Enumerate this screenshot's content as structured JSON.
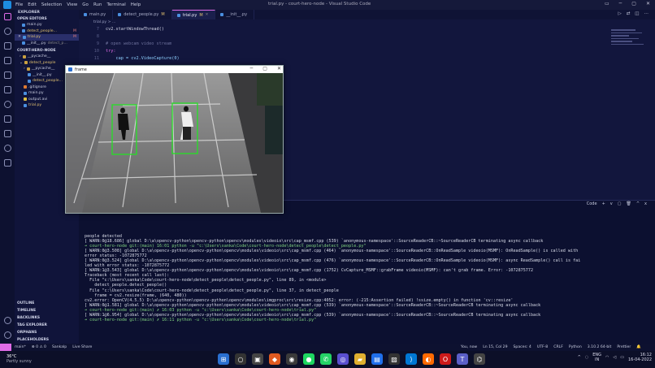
{
  "window": {
    "title": "trial.py - court-hero-node - Visual Studio Code",
    "menu": [
      "File",
      "Edit",
      "Selection",
      "View",
      "Go",
      "Run",
      "Terminal",
      "Help"
    ]
  },
  "sidebar": {
    "header": "EXPLORER",
    "open_editors_label": "OPEN EDITORS",
    "open_editors": [
      {
        "name": "main.py",
        "mark": ""
      },
      {
        "name": "detect_people...",
        "mark": "M"
      },
      {
        "name": "trial.py",
        "mark": "M"
      },
      {
        "name": "__init__.py",
        "mark": "detect_p..."
      }
    ],
    "project_label": "COURT-HERO-NODE",
    "tree": [
      {
        "name": "__pycache__",
        "kind": "folder"
      },
      {
        "name": "detect_people",
        "kind": "folder"
      },
      {
        "name": "__pycache__",
        "kind": "folder"
      },
      {
        "name": "__init__.py",
        "kind": "py"
      },
      {
        "name": "detect_people...",
        "kind": "py",
        "mark": "M"
      },
      {
        "name": ".gitignore",
        "kind": "git"
      },
      {
        "name": "main.py",
        "kind": "py"
      },
      {
        "name": "output.avi",
        "kind": "file"
      },
      {
        "name": "trial.py",
        "kind": "py"
      }
    ],
    "bottom_sections": [
      "OUTLINE",
      "TIMELINE",
      "BACKLINKS",
      "TAG EXPLORER",
      "ORPHANS",
      "PLACEHOLDERS"
    ]
  },
  "tabs": [
    {
      "label": "main.py",
      "mark": "",
      "active": false
    },
    {
      "label": "detect_people.py",
      "mark": "M",
      "active": false
    },
    {
      "label": "trial.py",
      "mark": "M",
      "active": true
    },
    {
      "label": "__init__.py",
      "mark": "",
      "active": false
    }
  ],
  "breadcrumb": "trial.py > ...",
  "code": {
    "top_line": "cv2.startWindowThread()",
    "lines": [
      {
        "n": "7",
        "text": "cv2.startWindowThread()",
        "cls": "c-tx"
      },
      {
        "n": "8",
        "text": "",
        "cls": "c-tx"
      },
      {
        "n": "9",
        "text": "# open webcam video stream",
        "cls": "c-cm"
      },
      {
        "n": "10",
        "text": "try:",
        "cls": "c-kw"
      },
      {
        "n": "11",
        "text": "    cap = cv2.VideoCapture(0)",
        "cls": "c-id"
      }
    ]
  },
  "frame_window": {
    "title": "frame",
    "detections": 2
  },
  "panel": {
    "toolbar": [
      "Code",
      "+",
      "v",
      "▢",
      "🗑",
      "^",
      "x"
    ]
  },
  "terminal": [
    {
      "cls": "tl-warn",
      "text": "people detected"
    },
    {
      "cls": "tl-warn",
      "text": "[ WARN:0@18.686] global D:\\a\\opencv-python\\opencv-python\\opencv\\modules\\videoio\\src\\cap_msmf.cpp (539) `anonymous-namespace'::SourceReaderCB::~SourceReaderCB terminating async callback"
    },
    {
      "cls": "tl-prompt",
      "text": "➜ court-hero-node git:(main) 16:01 python -u \"c:\\Users\\sanka\\Code\\court-hero-node\\detect_people\\detect_people.py\""
    },
    {
      "cls": "tl-warn",
      "text": "[ WARN:0@3.508] global D:\\a\\opencv-python\\opencv-python\\opencv\\modules\\videoio\\src\\cap_msmf.cpp (464) `anonymous-namespace'::SourceReaderCB::OnReadSample videoio(MSMF): OnReadSample() is called with"
    },
    {
      "cls": "tl-warn",
      "text": "error status: -1072875772"
    },
    {
      "cls": "tl-warn",
      "text": "[ WARN:0@3.524] global D:\\a\\opencv-python\\opencv-python\\opencv\\modules\\videoio\\src\\cap_msmf.cpp (476) `anonymous-namespace'::SourceReaderCB::OnReadSample videoio(MSMF): async ReadSample() call is fai"
    },
    {
      "cls": "tl-warn",
      "text": "led with error status: -1072875772"
    },
    {
      "cls": "tl-warn",
      "text": "[ WARN:1@3.543] global D:\\a\\opencv-python\\opencv-python\\opencv\\modules\\videoio\\src\\cap_msmf.cpp (1752) CvCapture_MSMF::grabFrame videoio(MSMF): can't grab frame. Error: -1072875772"
    },
    {
      "cls": "tl-warn",
      "text": "Traceback (most recent call last):"
    },
    {
      "cls": "tl-warn",
      "text": "  File \"c:\\Users\\sanka\\Code\\court-hero-node\\detect_people\\detect_people.py\", line 89, in <module>"
    },
    {
      "cls": "tl-warn",
      "text": "    detect_people.detect_people()"
    },
    {
      "cls": "tl-warn",
      "text": "  File \"c:\\Users\\sanka\\Code\\court-hero-node\\detect_people\\detect_people.py\", line 37, in detect_people"
    },
    {
      "cls": "tl-warn",
      "text": "    frame = cv2.resize(frame, (640, 480))"
    },
    {
      "cls": "tl-warn",
      "text": "cv2.error: OpenCV(4.5.5) D:\\a\\opencv-python\\opencv-python\\opencv\\modules\\imgproc\\src\\resize.cpp:4052: error: (-215:Assertion failed) !ssize.empty() in function 'cv::resize'"
    },
    {
      "cls": "tl-warn",
      "text": ""
    },
    {
      "cls": "tl-warn",
      "text": "[ WARN:0@1.581] global D:\\a\\opencv-python\\opencv-python\\opencv\\modules\\videoio\\src\\cap_msmf.cpp (539) `anonymous-namespace'::SourceReaderCB::~SourceReaderCB terminating async callback"
    },
    {
      "cls": "tl-prompt",
      "text": "➜ court-hero-node git:(main) ✗ 16:03 python -u \"c:\\Users\\sanka\\Code\\court-hero-node\\trial.py\""
    },
    {
      "cls": "tl-warn",
      "text": "[ WARN:1@6.954] global D:\\a\\opencv-python\\opencv-python\\opencv\\modules\\videoio\\src\\cap_msmf.cpp (539) `anonymous-namespace'::SourceReaderCB::~SourceReaderCB terminating async callback"
    },
    {
      "cls": "tl-prompt",
      "text": "➜ court-hero-node git:(main) ✗ 16:11 python -u \"c:\\Users\\sanka\\Code\\court-hero-node\\trial.py\""
    }
  ],
  "statusbar": {
    "left": [
      "main*",
      "⊗ 0 ⚠ 0",
      "Sankalp",
      "Live Share"
    ],
    "right": [
      "You, now",
      "Ln 15, Col 29",
      "Spaces: 4",
      "UTF-8",
      "CRLF",
      "Python",
      "3.10.2 64-bit",
      "Prettier"
    ]
  },
  "taskbar": {
    "weather_temp": "36°C",
    "weather_desc": "Partly sunny",
    "lang_top": "ENG",
    "lang_bottom": "IN",
    "time": "16:12",
    "date": "16-04-2022"
  },
  "colors": {
    "accent": "#e06ce8",
    "box": "#25e025"
  }
}
